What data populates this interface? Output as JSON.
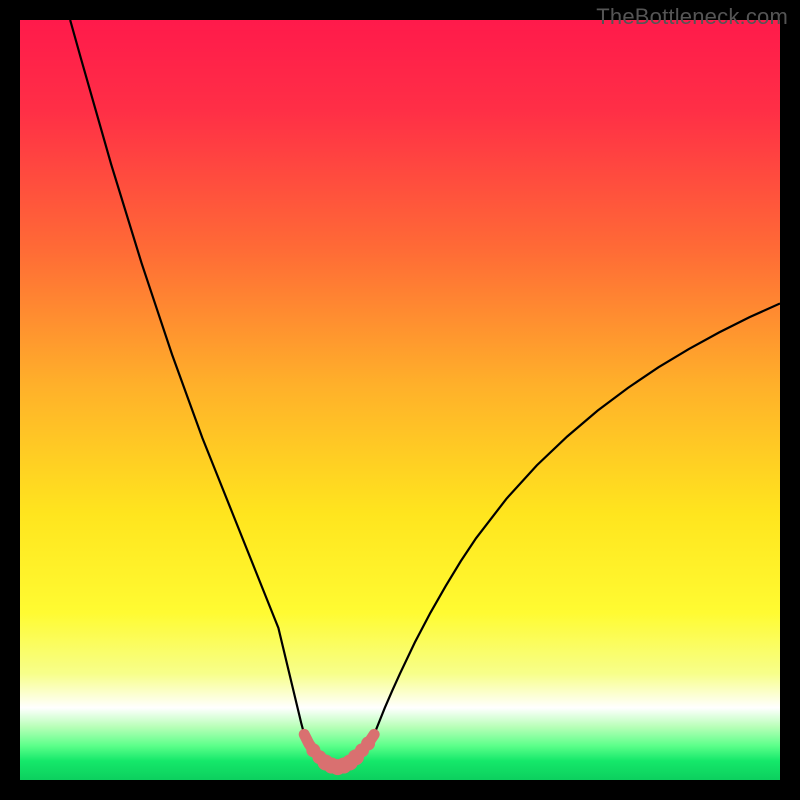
{
  "watermark": "TheBottleneck.com",
  "colors": {
    "frame": "#000000",
    "gradient_stops": [
      {
        "offset": 0.0,
        "color": "#ff1a4b"
      },
      {
        "offset": 0.12,
        "color": "#ff2f46"
      },
      {
        "offset": 0.3,
        "color": "#ff6a36"
      },
      {
        "offset": 0.48,
        "color": "#ffb02a"
      },
      {
        "offset": 0.65,
        "color": "#ffe51e"
      },
      {
        "offset": 0.78,
        "color": "#fffb32"
      },
      {
        "offset": 0.86,
        "color": "#f7ff8a"
      },
      {
        "offset": 0.905,
        "color": "#ffffff"
      },
      {
        "offset": 0.93,
        "color": "#b8ffb8"
      },
      {
        "offset": 0.955,
        "color": "#5cff8a"
      },
      {
        "offset": 0.975,
        "color": "#15e86a"
      },
      {
        "offset": 1.0,
        "color": "#0ccf5e"
      }
    ],
    "curve_stroke": "#000000",
    "marker_fill": "#d97070",
    "marker_trough_stroke": "#d97070"
  },
  "chart_data": {
    "type": "line",
    "title": "",
    "xlabel": "",
    "ylabel": "",
    "xlim": [
      0,
      100
    ],
    "ylim": [
      0,
      100
    ],
    "x": [
      6.6,
      8,
      10,
      12,
      14,
      16,
      18,
      20,
      22,
      24,
      26,
      28,
      30,
      31,
      32,
      33,
      34,
      34.6,
      35.2,
      35.8,
      36.4,
      37,
      37.4,
      38,
      39,
      40,
      41,
      42,
      43,
      44,
      45,
      46,
      46.6,
      47.2,
      48,
      49,
      50,
      52,
      54,
      56,
      58,
      60,
      64,
      68,
      72,
      76,
      80,
      84,
      88,
      92,
      96,
      100
    ],
    "values": [
      100,
      95,
      88,
      81,
      74.5,
      68,
      62,
      56,
      50.5,
      45,
      40,
      35,
      30,
      27.5,
      25,
      22.5,
      20,
      17.5,
      15,
      12.5,
      10,
      7.5,
      6,
      4.8,
      3.2,
      2.2,
      1.7,
      1.55,
      1.7,
      2.2,
      3.2,
      4.8,
      6,
      7.5,
      9.5,
      11.8,
      14,
      18.2,
      22,
      25.5,
      28.8,
      31.8,
      37,
      41.4,
      45.2,
      48.6,
      51.6,
      54.3,
      56.7,
      58.9,
      60.9,
      62.7
    ],
    "markers": {
      "x": [
        37.4,
        38.0,
        38.6,
        39.4,
        40.2,
        41.0,
        41.8,
        42.6,
        43.4,
        44.2,
        45.0,
        45.8,
        46.6
      ],
      "values": [
        6.0,
        4.8,
        3.9,
        3.0,
        2.3,
        1.9,
        1.7,
        1.9,
        2.3,
        3.0,
        3.9,
        4.8,
        6.0
      ],
      "r": [
        5,
        5,
        7,
        7,
        8,
        8,
        8,
        8,
        8,
        8,
        7,
        7,
        5
      ]
    }
  }
}
